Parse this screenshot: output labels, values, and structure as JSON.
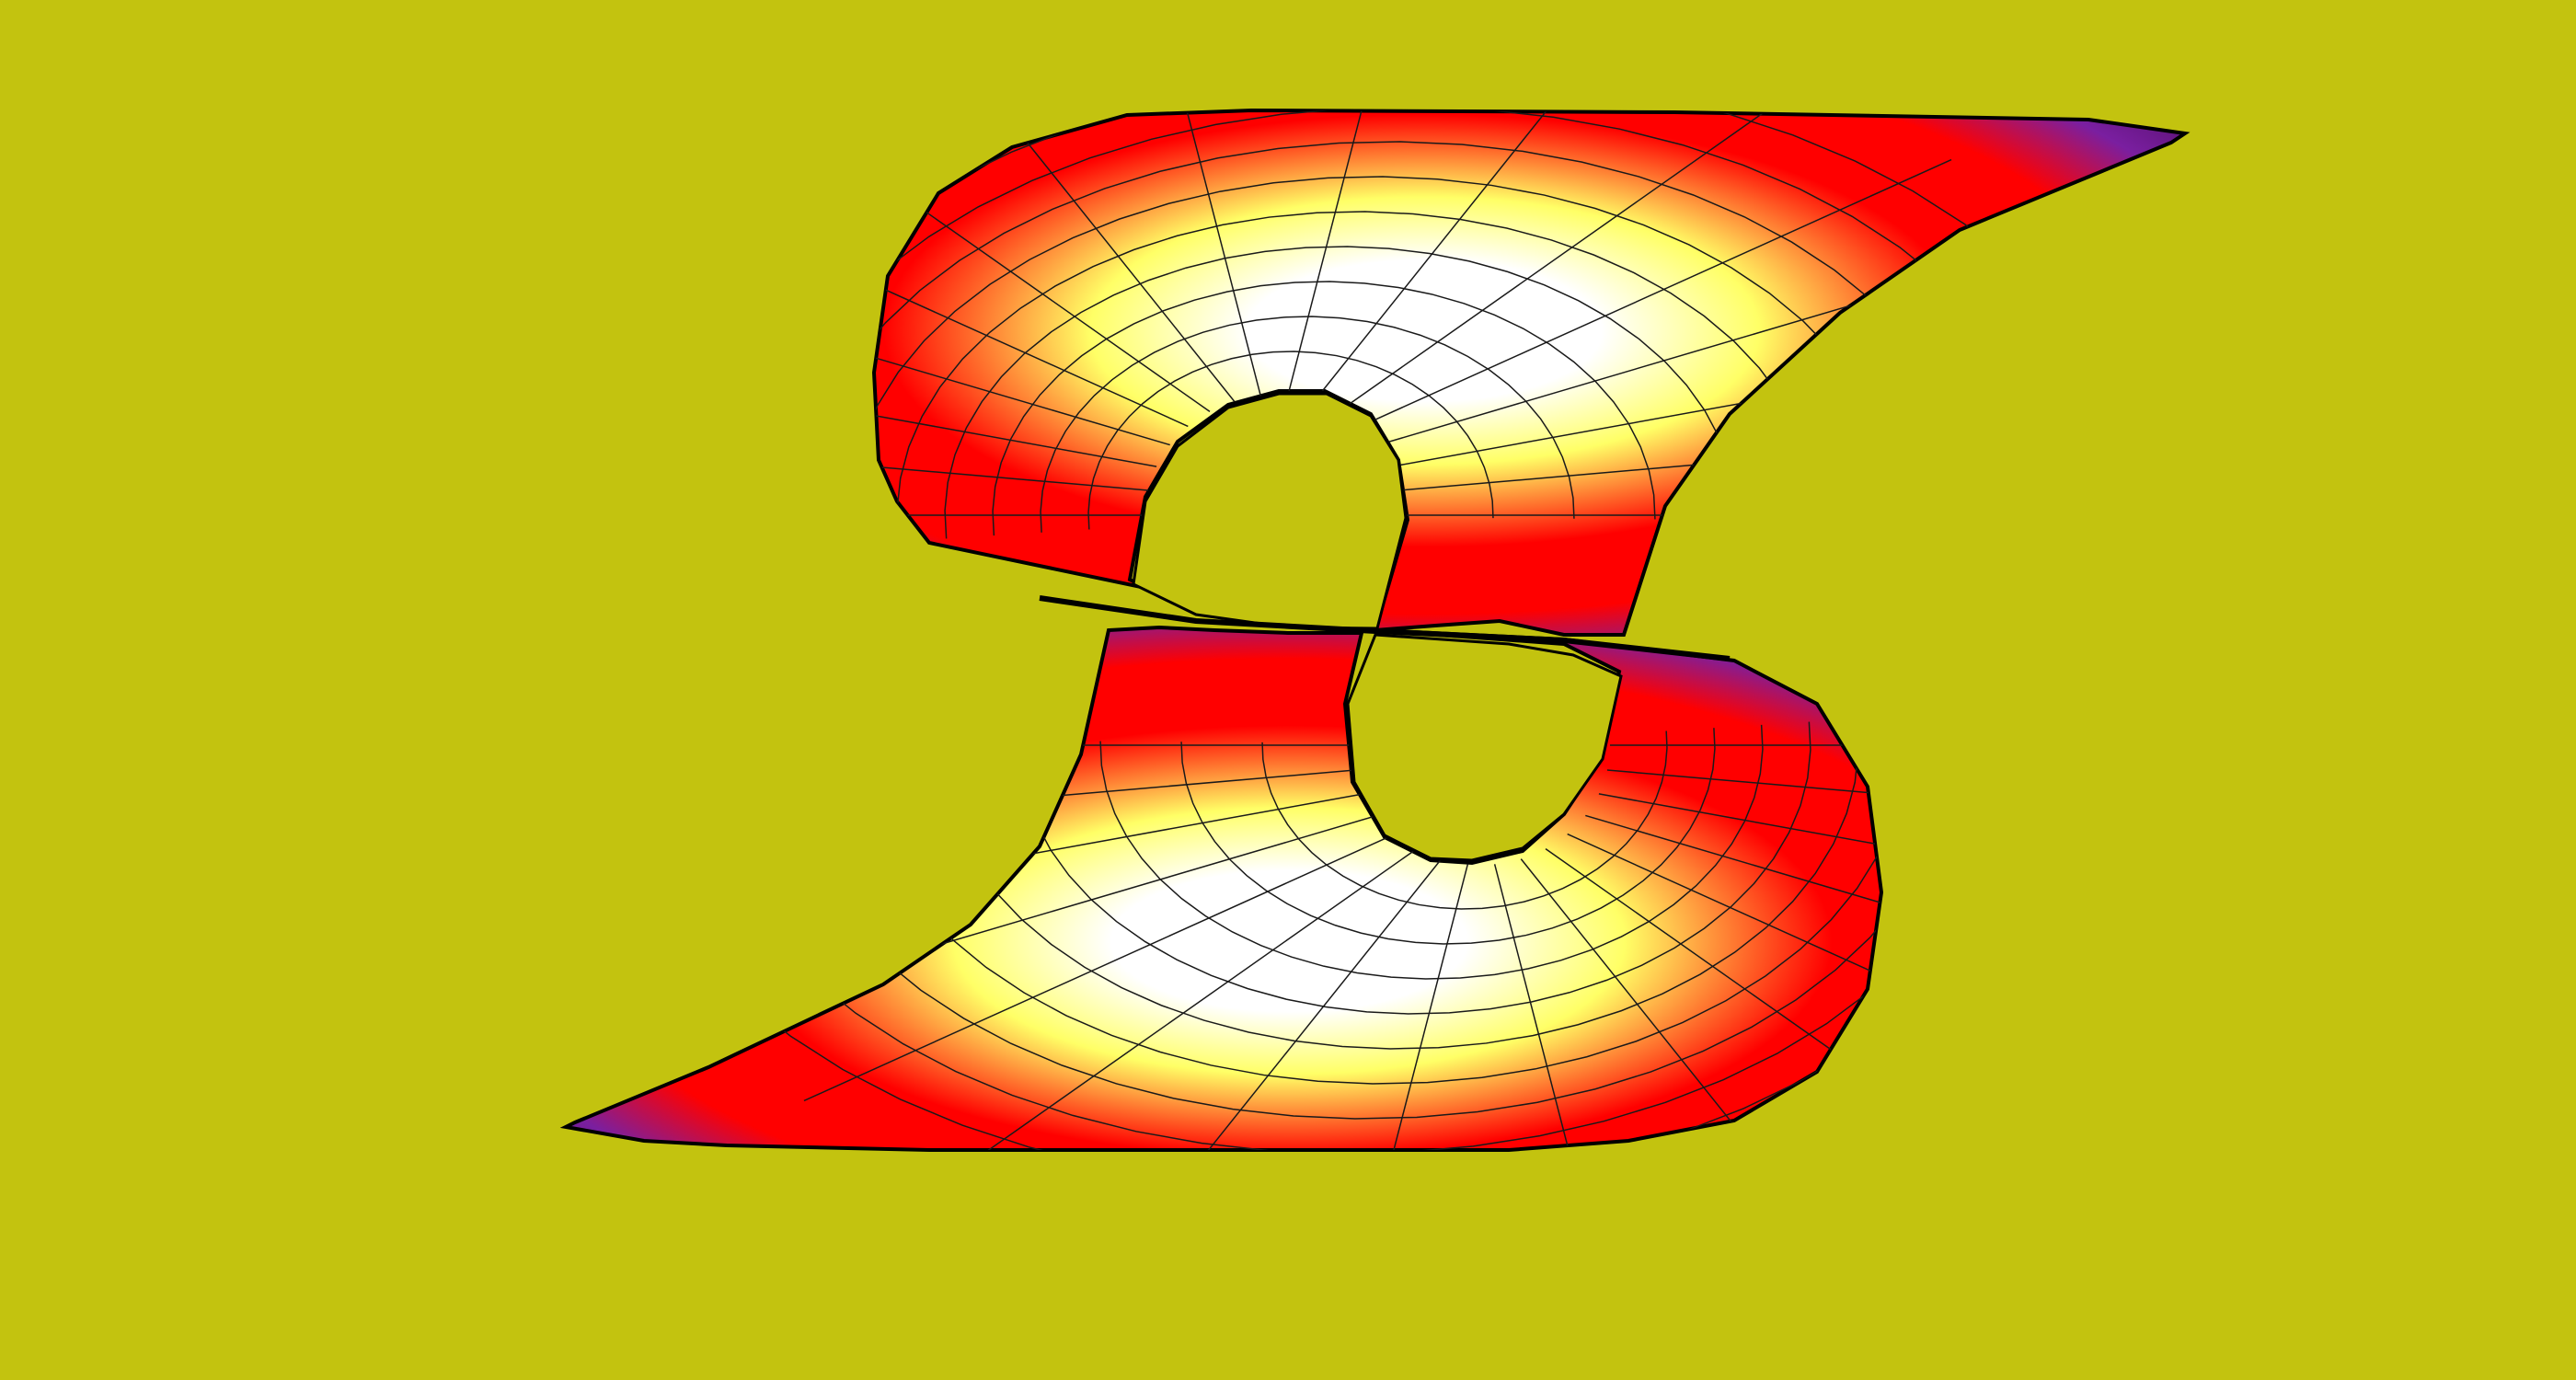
{
  "scene": {
    "colors": {
      "background": "#c3c30f",
      "surface_low": "#4a0a5c",
      "surface_mid_low": "#7a1fa0",
      "surface_mid": "#ff0000",
      "surface_mid_high": "#ffff66",
      "surface_high": "#ffffff",
      "edge": "#000000",
      "mesh_line": "#1a1a1a"
    },
    "shape": "twisted-s-surface",
    "shading": "height-colormap",
    "wireframe": true
  }
}
